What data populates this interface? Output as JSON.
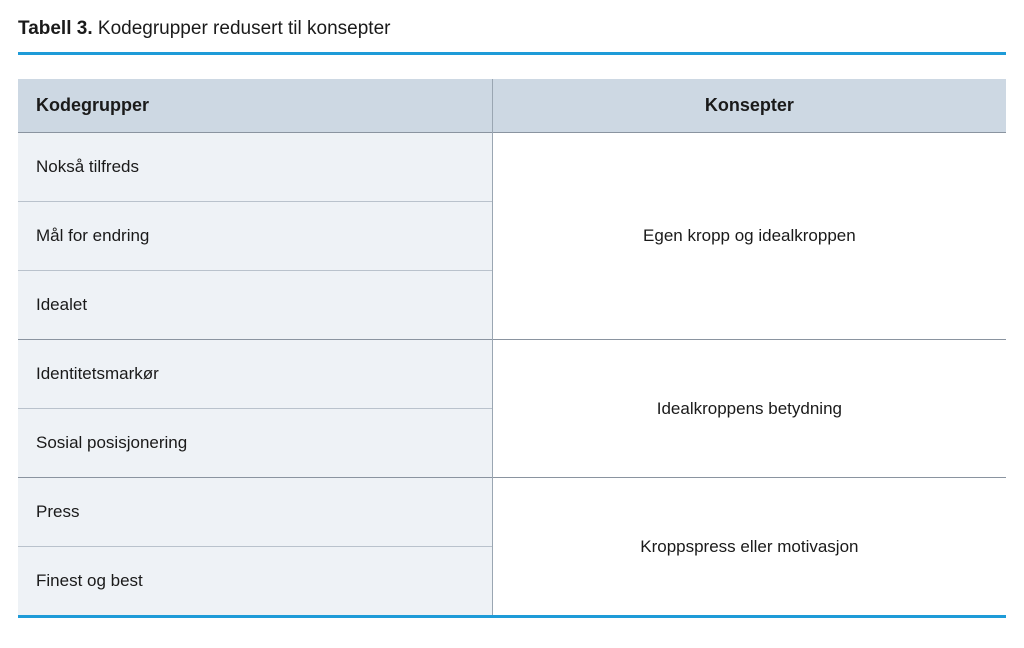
{
  "caption": {
    "label": "Tabell 3.",
    "title": "Kodegrupper redusert til konsepter"
  },
  "headers": {
    "col1": "Kodegrupper",
    "col2": "Konsepter"
  },
  "groups": [
    {
      "concept": "Egen kropp og idealkroppen",
      "codes": [
        "Nokså tilfreds",
        "Mål for endring",
        "Idealet"
      ]
    },
    {
      "concept": "Idealkroppens betydning",
      "codes": [
        "Identitetsmarkør",
        "Sosial posisjonering"
      ]
    },
    {
      "concept": "Kroppspress eller motivasjon",
      "codes": [
        "Press",
        "Finest og best"
      ]
    }
  ],
  "chart_data": {
    "type": "table",
    "title": "Tabell 3. Kodegrupper redusert til konsepter",
    "columns": [
      "Kodegrupper",
      "Konsepter"
    ],
    "rows": [
      [
        "Nokså tilfreds",
        "Egen kropp og idealkroppen"
      ],
      [
        "Mål for endring",
        "Egen kropp og idealkroppen"
      ],
      [
        "Idealet",
        "Egen kropp og idealkroppen"
      ],
      [
        "Identitetsmarkør",
        "Idealkroppens betydning"
      ],
      [
        "Sosial posisjonering",
        "Idealkroppens betydning"
      ],
      [
        "Press",
        "Kroppspress eller motivasjon"
      ],
      [
        "Finest og best",
        "Kroppspress eller motivasjon"
      ]
    ]
  }
}
